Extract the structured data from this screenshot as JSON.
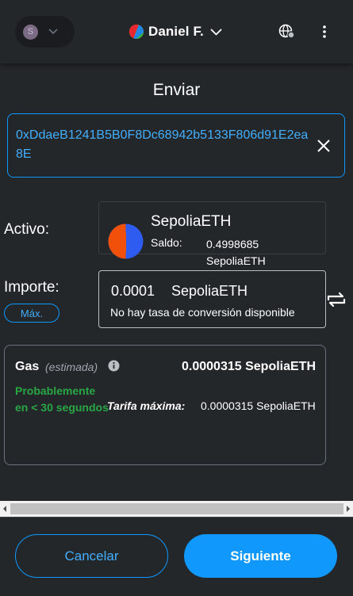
{
  "header": {
    "network_initial": "S",
    "account_name": "Daniel F."
  },
  "page": {
    "title": "Enviar"
  },
  "recipient": {
    "address": "0xDdaeB1241B5B0F8Dc68942b5133F806d91E2ea8E"
  },
  "asset": {
    "label": "Activo:",
    "name": "SepoliaETH",
    "balance_label": "Saldo:",
    "balance_value": "0.4998685",
    "balance_unit": "SepoliaETH"
  },
  "amount": {
    "label": "Importe:",
    "max_label": "Máx.",
    "value": "0.0001",
    "unit": "SepoliaETH",
    "conversion_text": "No hay tasa de conversión disponible"
  },
  "gas": {
    "title": "Gas",
    "estimate_label": "(estimada)",
    "amount": "0.0000315 SepoliaETH",
    "time_estimate": "Probablemente en < 30 segundos",
    "max_fee_label": "Tarifa máxima:",
    "max_fee_value": "0.0000315 SepoliaETH"
  },
  "footer": {
    "cancel_label": "Cancelar",
    "next_label": "Siguiente"
  },
  "colors": {
    "background": "#24272a",
    "accent": "#1098fc",
    "success": "#28a745",
    "asset_icon_blue": "#2e5bf0",
    "asset_icon_red": "#f0500a"
  },
  "icons": {
    "network": "network-avatar-icon",
    "account": "account-avatar-icon",
    "globe": "globe-connection-icon",
    "menu": "kebab-menu-icon",
    "clear": "close-icon",
    "swap": "swap-icon",
    "info": "info-icon"
  }
}
